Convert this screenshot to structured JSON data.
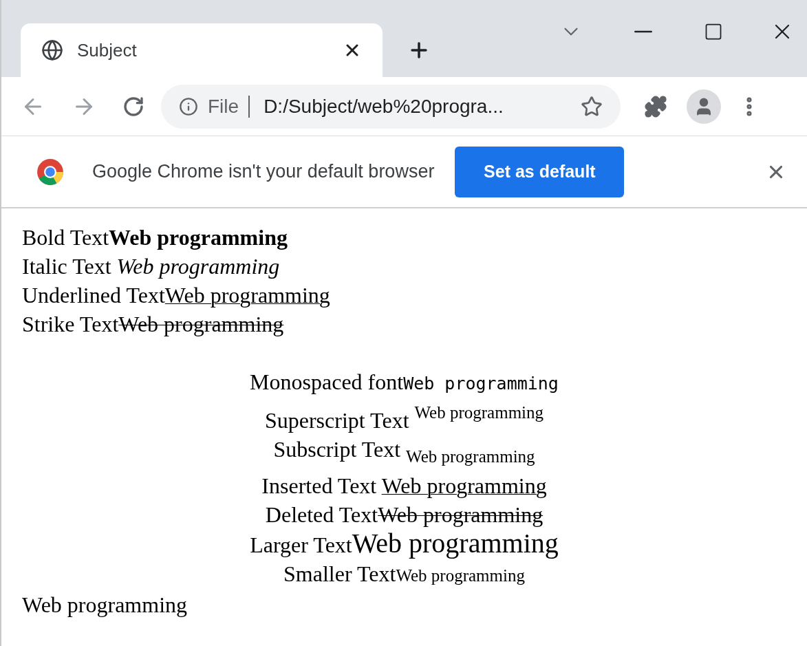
{
  "tab": {
    "title": "Subject",
    "selected": true
  },
  "toolbar": {
    "scheme": "File",
    "address": "D:/Subject/web%20progra..."
  },
  "infobar": {
    "message": "Google Chrome isn't your default browser",
    "button": "Set as default"
  },
  "left_lines": [
    {
      "label": "Bold Text",
      "sample": "Web programming",
      "kind": "bold"
    },
    {
      "label": "Italic Text ",
      "sample": "Web programming",
      "kind": "italic"
    },
    {
      "label": "Underlined Text",
      "sample": "Web programming",
      "kind": "underline"
    },
    {
      "label": "Strike Text",
      "sample": "Web programming",
      "kind": "strike"
    }
  ],
  "center_lines": [
    {
      "label": "Monospaced font",
      "sample": "Web programming",
      "kind": "mono"
    },
    {
      "label": "Superscript Text ",
      "sample": "Web programming",
      "kind": "sup"
    },
    {
      "label": "Subscript Text ",
      "sample": "Web programming",
      "kind": "sub"
    },
    {
      "label": "Inserted Text ",
      "sample": "Web programming",
      "kind": "underline"
    },
    {
      "label": "Deleted Text",
      "sample": "Web programming",
      "kind": "strike"
    },
    {
      "label": "Larger Text",
      "sample": "Web programming",
      "kind": "big"
    },
    {
      "label": "Smaller Text",
      "sample": "Web programming",
      "kind": "small"
    }
  ],
  "footer": "Web programming"
}
